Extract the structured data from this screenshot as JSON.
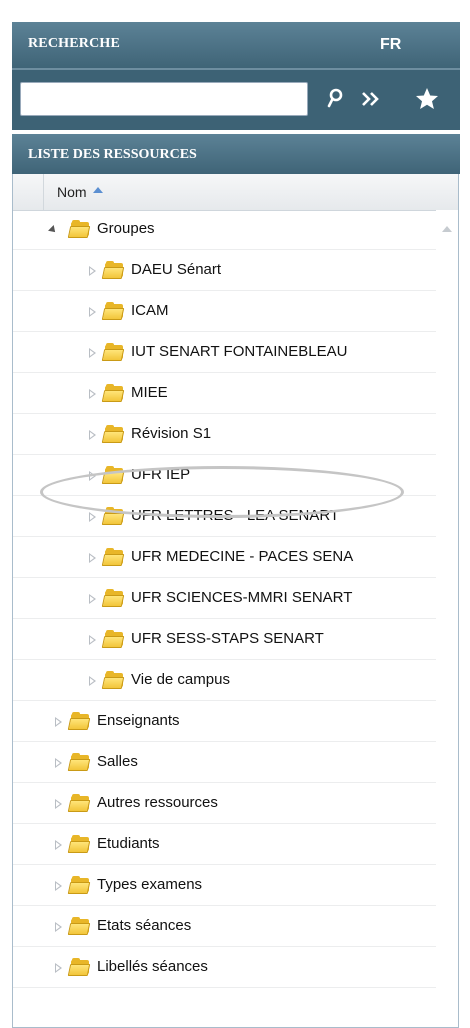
{
  "search": {
    "title": "RECHERCHE",
    "language": "FR",
    "input_value": "",
    "icons": [
      "search-icon",
      "double-chevron-right-icon",
      "star-icon"
    ]
  },
  "resources": {
    "title": "LISTE DES RESSOURCES",
    "column_header": "Nom",
    "sort": "ascending",
    "highlighted_item": "UFR IEP",
    "tree": [
      {
        "label": "Groupes",
        "level": 0,
        "expanded": true
      },
      {
        "label": "DAEU Sénart",
        "level": 1,
        "expanded": false
      },
      {
        "label": "ICAM",
        "level": 1,
        "expanded": false
      },
      {
        "label": "IUT SENART FONTAINEBLEAU",
        "level": 1,
        "expanded": false
      },
      {
        "label": "MIEE",
        "level": 1,
        "expanded": false
      },
      {
        "label": "Révision S1",
        "level": 1,
        "expanded": false
      },
      {
        "label": "UFR IEP",
        "level": 1,
        "expanded": false
      },
      {
        "label": "UFR LETTRES - LEA SENART",
        "level": 1,
        "expanded": false
      },
      {
        "label": "UFR MEDECINE - PACES SENA",
        "level": 1,
        "expanded": false
      },
      {
        "label": "UFR SCIENCES-MMRI SENART",
        "level": 1,
        "expanded": false
      },
      {
        "label": "UFR SESS-STAPS SENART",
        "level": 1,
        "expanded": false
      },
      {
        "label": "Vie de campus",
        "level": 1,
        "expanded": false
      },
      {
        "label": "Enseignants",
        "level": 0,
        "expanded": false
      },
      {
        "label": "Salles",
        "level": 0,
        "expanded": false
      },
      {
        "label": "Autres ressources",
        "level": 0,
        "expanded": false
      },
      {
        "label": "Etudiants",
        "level": 0,
        "expanded": false
      },
      {
        "label": "Types examens",
        "level": 0,
        "expanded": false
      },
      {
        "label": "Etats séances",
        "level": 0,
        "expanded": false
      },
      {
        "label": "Libellés séances",
        "level": 0,
        "expanded": false
      }
    ]
  },
  "colors": {
    "header_bg": "#4a6f83",
    "folder": "#f2c53a",
    "highlight_ellipse": "#c5c5c5"
  }
}
